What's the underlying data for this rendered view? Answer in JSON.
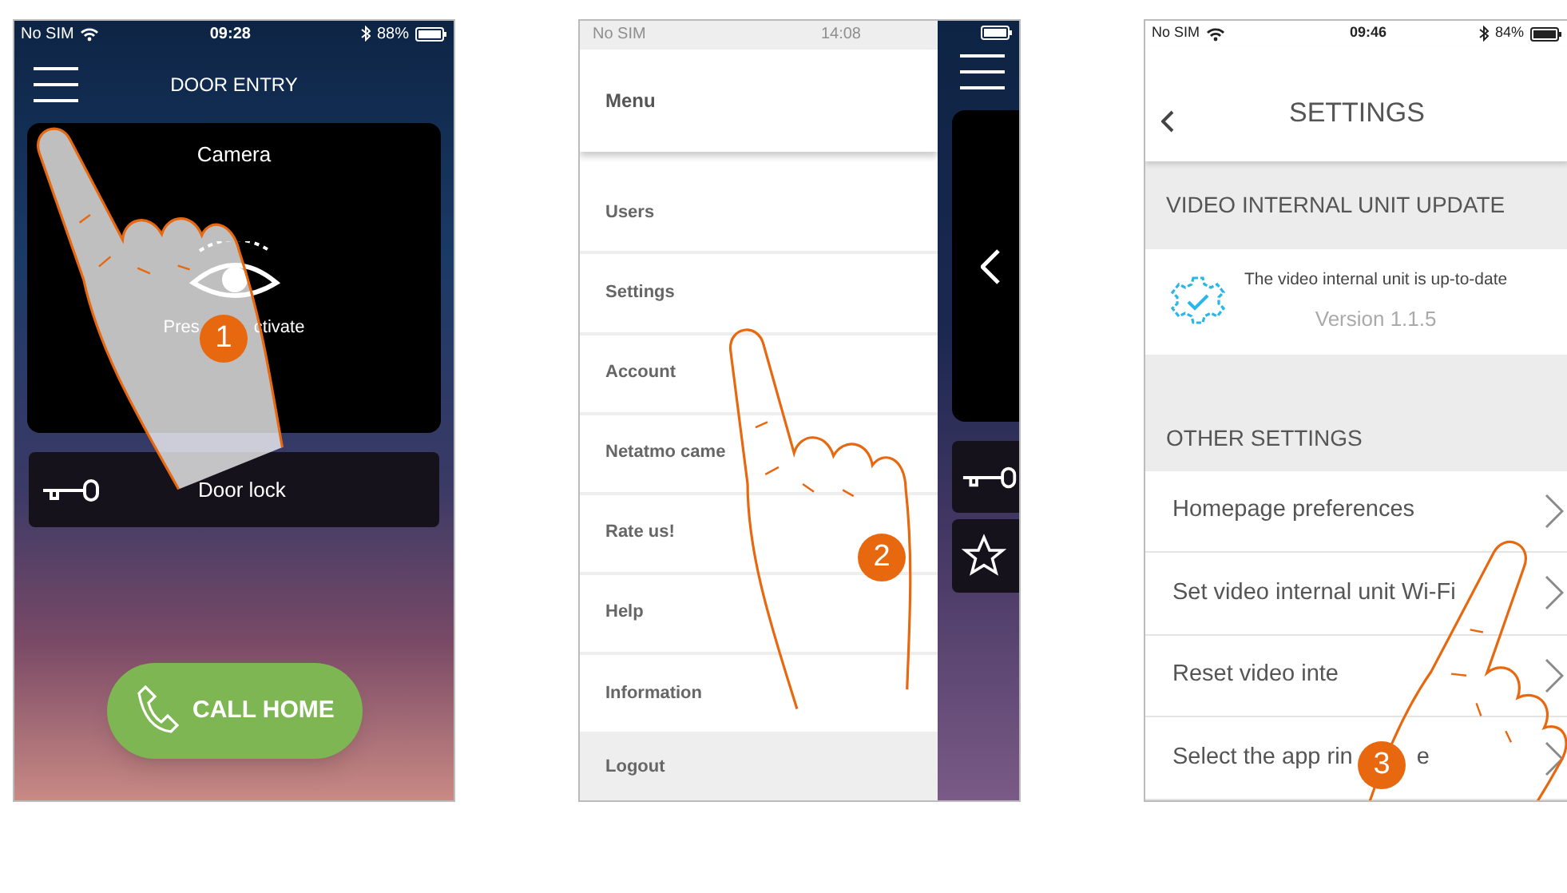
{
  "door_entry_screen": {
    "status_bar": {
      "carrier": "No SIM",
      "time": "09:28",
      "battery": "88%"
    },
    "title": "DOOR ENTRY",
    "camera": {
      "title": "Camera",
      "hint_parts": [
        "Pres",
        "ctivate"
      ]
    },
    "door_lock": {
      "label": "Door lock"
    },
    "call_button": {
      "label": "CALL HOME"
    },
    "step_badge": "1"
  },
  "menu_screen": {
    "status_bar": {
      "carrier": "No SIM",
      "time": "14:08"
    },
    "header": "Menu",
    "items": [
      {
        "label": "Users",
        "kind": "item"
      },
      {
        "label": "Settings",
        "kind": "item"
      },
      {
        "label": "Account",
        "kind": "item"
      },
      {
        "label": "Netatmo came",
        "kind": "item"
      },
      {
        "label": "Rate us!",
        "kind": "item"
      },
      {
        "label": "Help",
        "kind": "item"
      },
      {
        "label": "Information",
        "kind": "item"
      },
      {
        "label": "Logout",
        "kind": "logout"
      }
    ],
    "step_badge": "2"
  },
  "settings_screen": {
    "status_bar": {
      "carrier": "No SIM",
      "time": "09:46",
      "battery": "84%"
    },
    "title": "SETTINGS",
    "update_section": {
      "heading": "VIDEO INTERNAL UNIT UPDATE",
      "message": "The video internal unit is up-to-date",
      "version": "Version 1.1.5"
    },
    "other_section": {
      "heading": "OTHER SETTINGS",
      "rows": [
        {
          "label_parts": [
            "Homepage preferences"
          ]
        },
        {
          "label_parts": [
            "Set video internal unit Wi-Fi"
          ]
        },
        {
          "label_parts": [
            "Reset video inte"
          ]
        },
        {
          "label_parts": [
            "Select the app rin",
            "e"
          ]
        }
      ]
    },
    "step_badge": "3"
  }
}
